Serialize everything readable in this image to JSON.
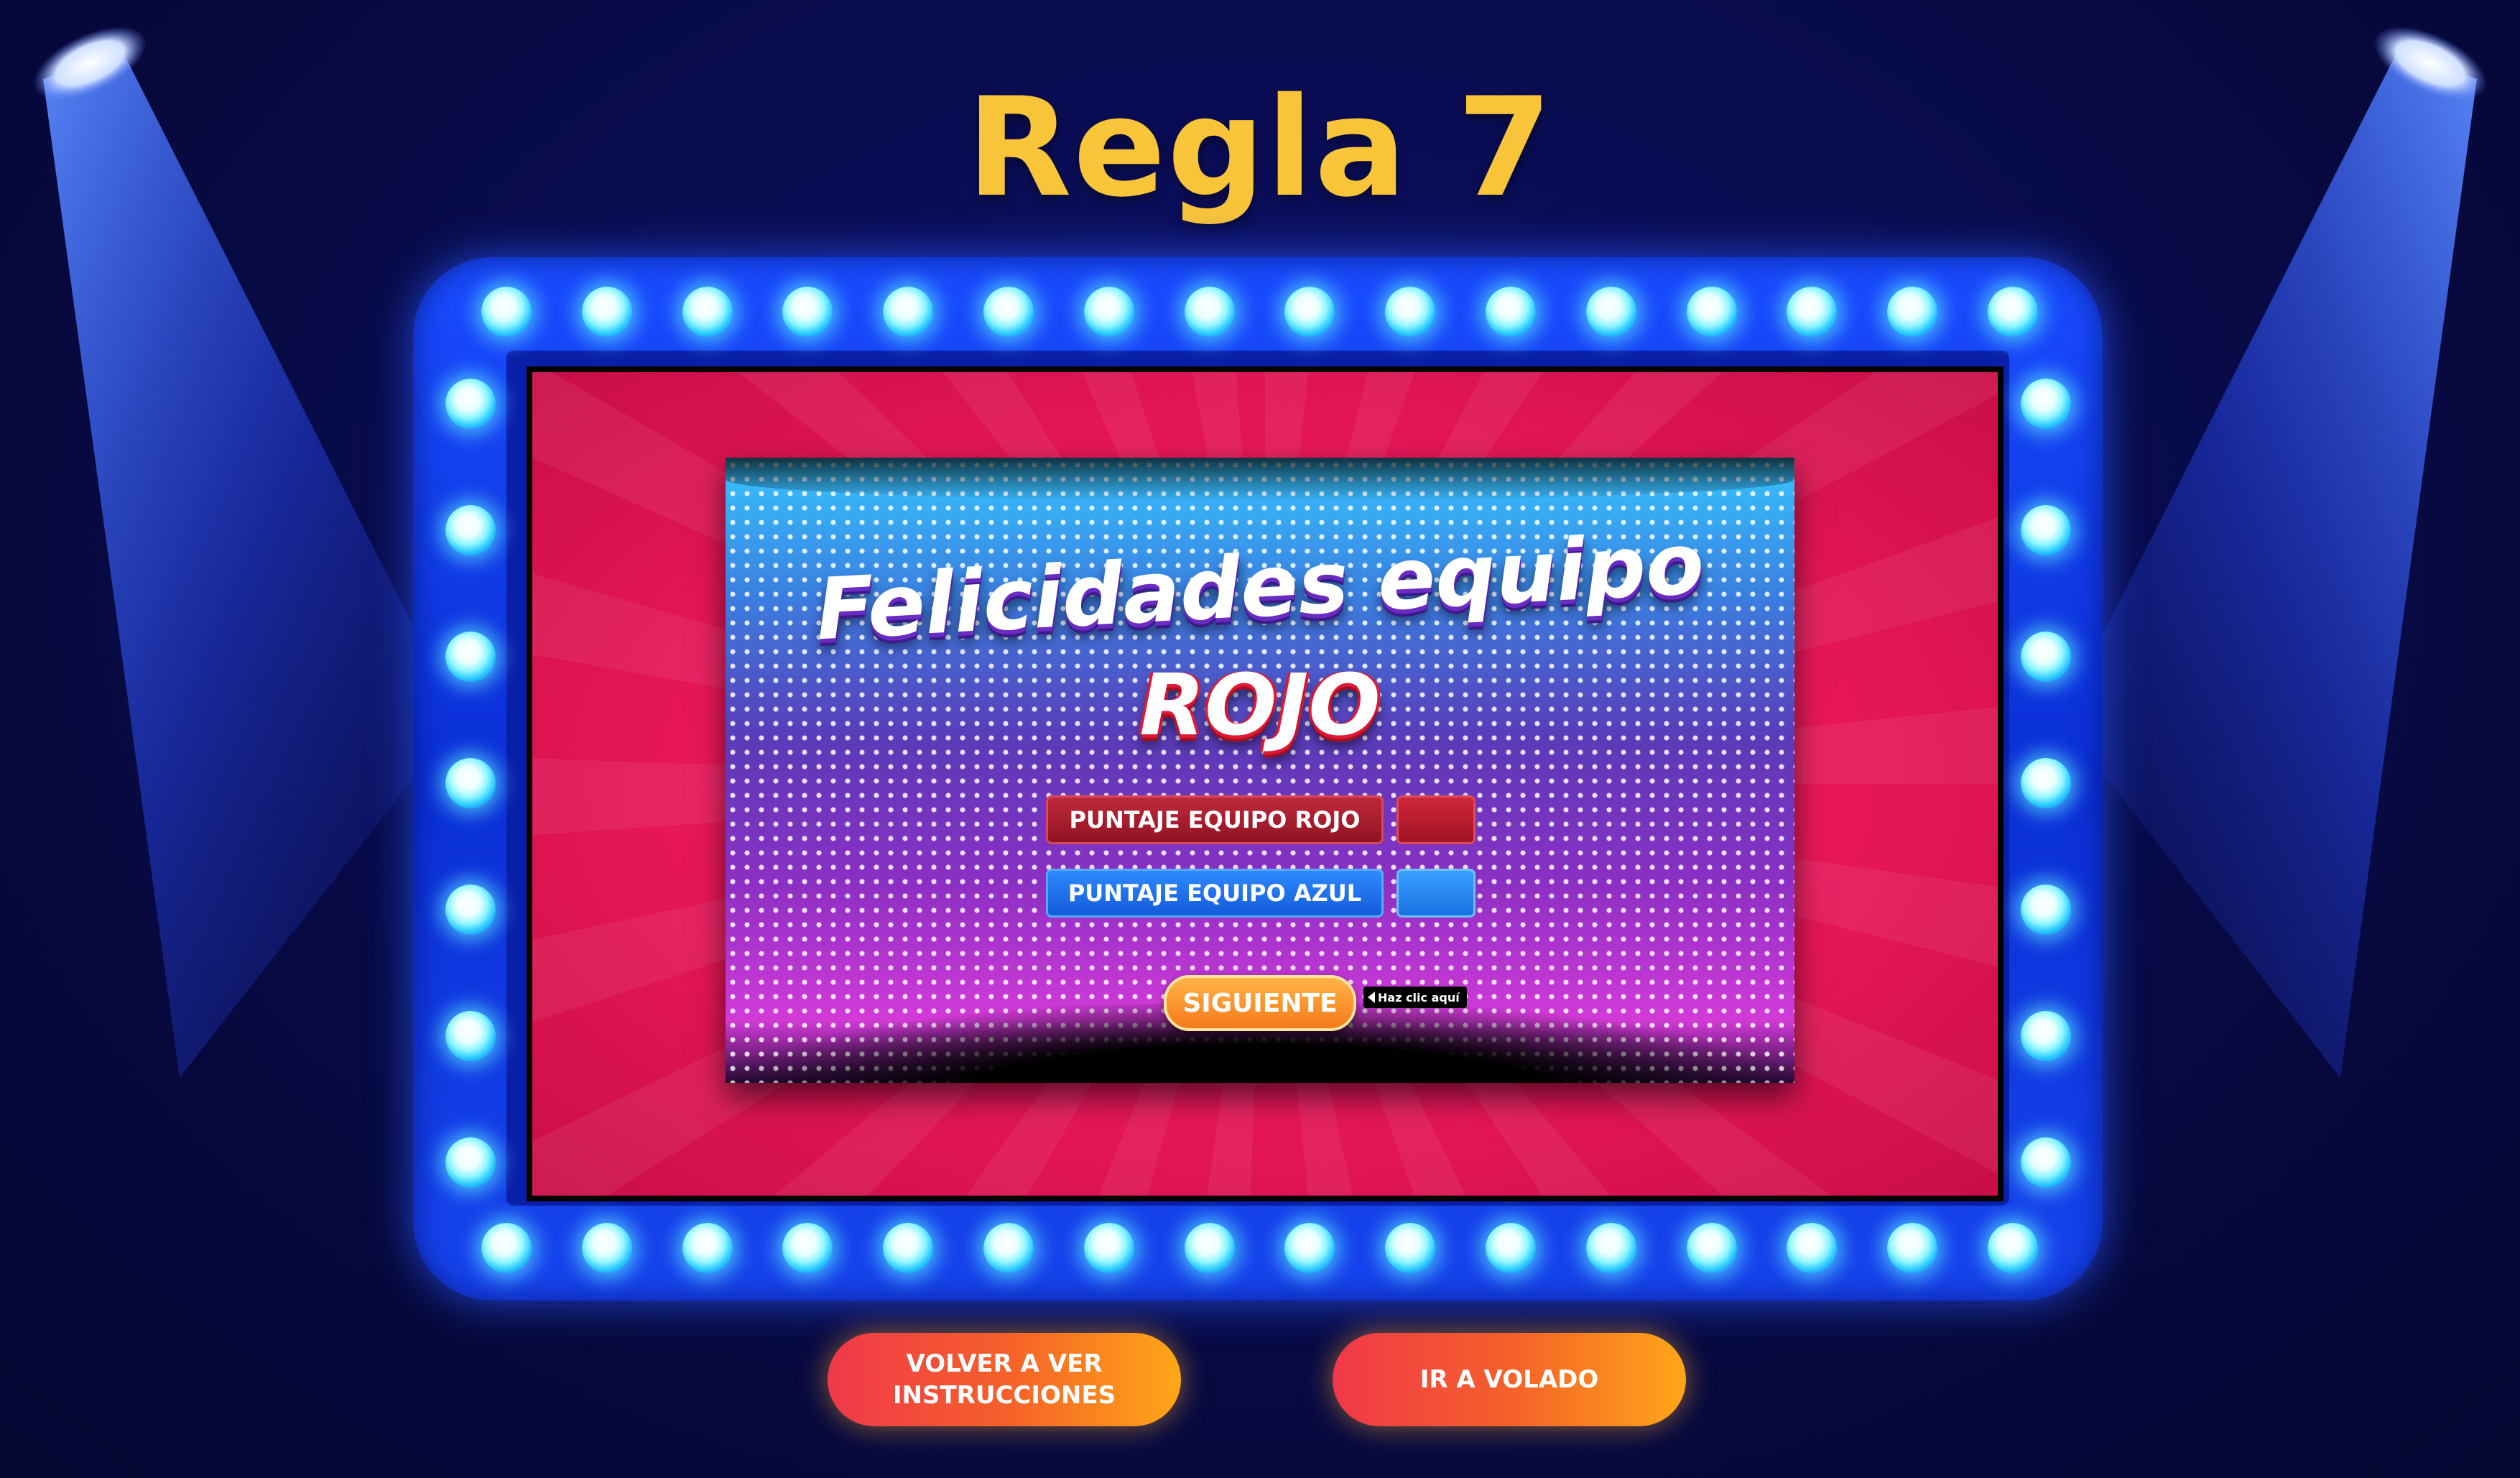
{
  "page": {
    "title": "Regla 7"
  },
  "game_panel": {
    "heading_line1": "Felicidades equipo",
    "heading_line2": "ROJO",
    "score_red_label": "PUNTAJE EQUIPO ROJO",
    "score_blue_label": "PUNTAJE EQUIPO AZUL",
    "score_red_value": "",
    "score_blue_value": "",
    "next_button_label": "SIGUIENTE",
    "hint_text": "Haz clic aquí"
  },
  "actions": {
    "back_to_instructions_line1": "VOLVER A VER",
    "back_to_instructions_line2": "INSTRUCCIONES",
    "go_to_volado": "IR A VOLADO"
  },
  "colors": {
    "title": "#f8c43a",
    "frame_blue": "#1a4cff",
    "screen_red": "#e8175a",
    "button_orange": "#f5602a"
  },
  "icons": [
    "spotlight-left-icon",
    "spotlight-right-icon",
    "marquee-bulb-icon",
    "hint-arrow-icon"
  ]
}
